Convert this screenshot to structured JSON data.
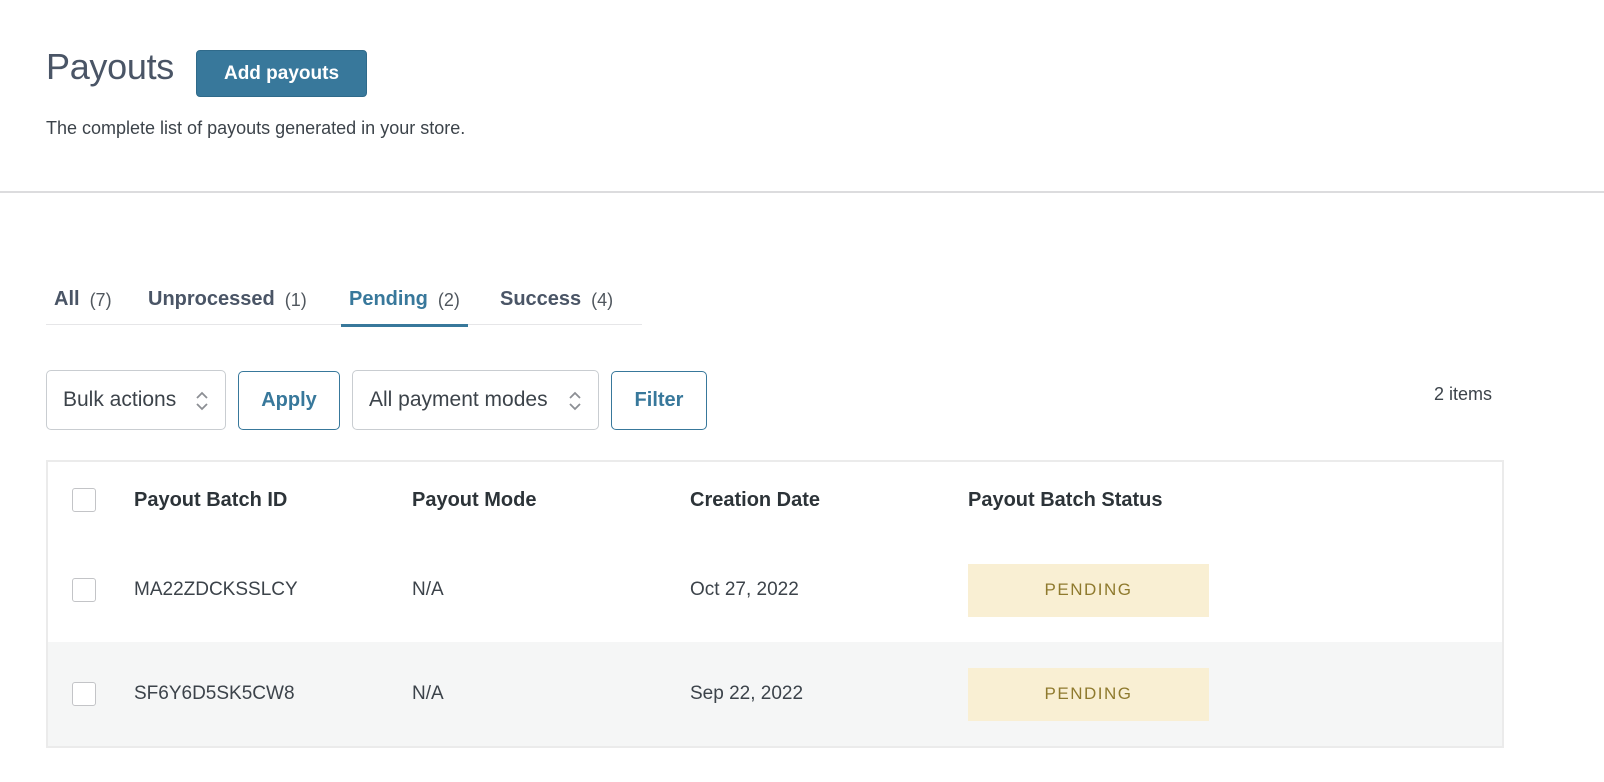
{
  "header": {
    "title": "Payouts",
    "add_button_label": "Add payouts",
    "subtitle": "The complete list of payouts generated in your store."
  },
  "tabs": [
    {
      "label": "All",
      "count": "(7)",
      "active": false
    },
    {
      "label": "Unprocessed",
      "count": "(1)",
      "active": false
    },
    {
      "label": "Pending",
      "count": "(2)",
      "active": true
    },
    {
      "label": "Success",
      "count": "(4)",
      "active": false
    }
  ],
  "toolbar": {
    "bulk_actions": "Bulk actions",
    "apply_label": "Apply",
    "payment_modes": "All payment modes",
    "filter_label": "Filter",
    "item_count": "2 items"
  },
  "table": {
    "columns": [
      "Payout Batch ID",
      "Payout Mode",
      "Creation Date",
      "Payout Batch Status"
    ],
    "rows": [
      {
        "id": "MA22ZDCKSSLCY",
        "mode": "N/A",
        "date": "Oct 27, 2022",
        "status": "PENDING"
      },
      {
        "id": "SF6Y6D5SK5CW8",
        "mode": "N/A",
        "date": "Sep 22, 2022",
        "status": "PENDING"
      }
    ]
  },
  "colors": {
    "accent": "#38789b",
    "pending_badge_bg": "#f9efd3",
    "pending_badge_text": "#8f7a2e"
  },
  "icons": {
    "select_chevron": "chevron-up-down-icon"
  }
}
